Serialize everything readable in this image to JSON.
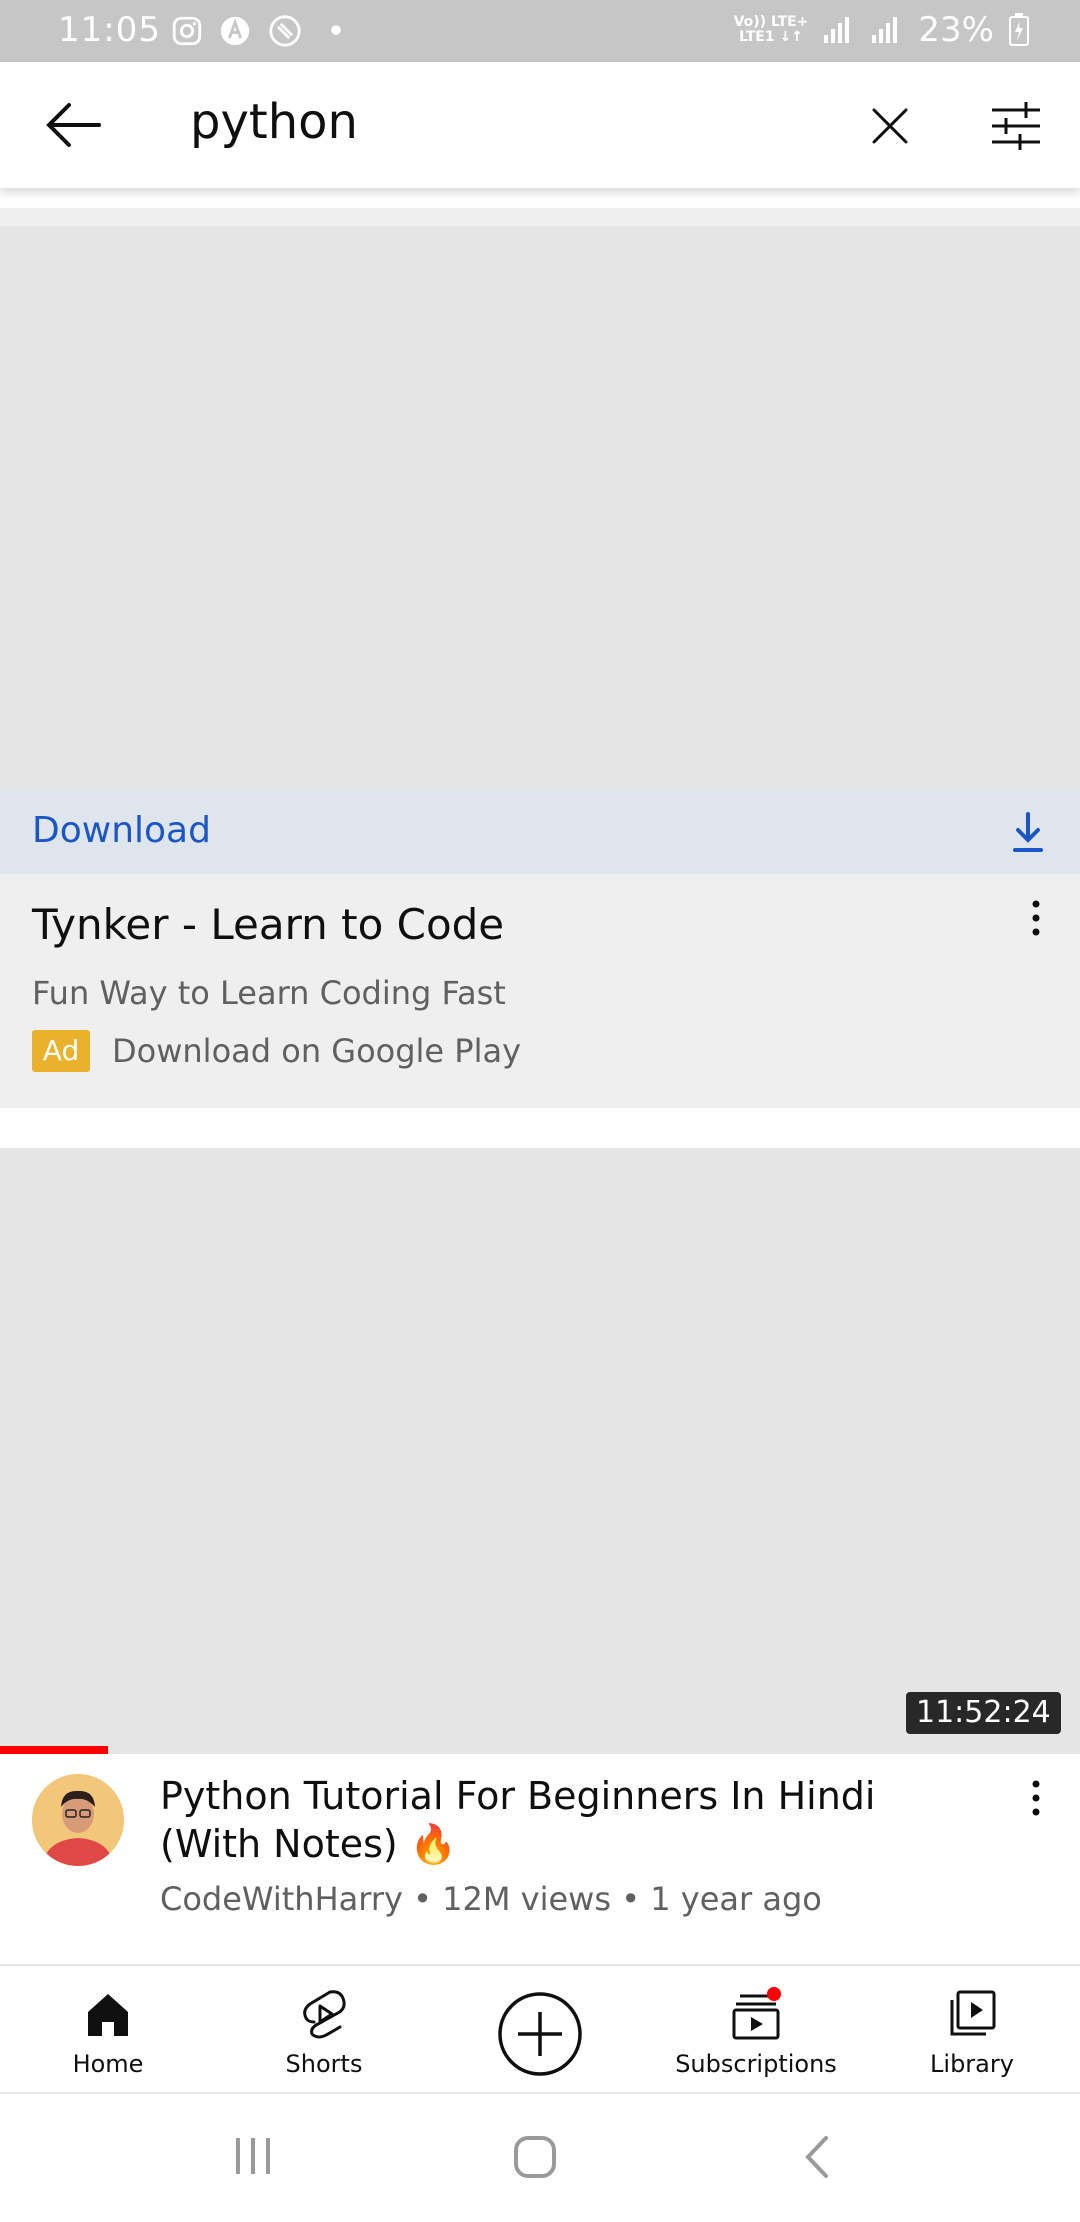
{
  "status_bar": {
    "time": "11:05",
    "network_top": "Vo)) LTE+",
    "network_bottom": "LTE1 ↓↑",
    "battery": "23%"
  },
  "search": {
    "query": "python"
  },
  "ad": {
    "cta_label": "Download",
    "title": "Tynker - Learn to Code",
    "description": "Fun Way to Learn Coding Fast",
    "badge": "Ad",
    "source": "Download on Google Play"
  },
  "video": {
    "duration": "11:52:24",
    "title": "Python Tutorial For Beginners In Hindi (With Notes) 🔥",
    "channel": "CodeWithHarry",
    "views": "12M views",
    "age": "1 year ago",
    "meta": "CodeWithHarry • 12M views • 1 year ago",
    "watch_progress": 0.1
  },
  "bottom_nav": {
    "home": "Home",
    "shorts": "Shorts",
    "subscriptions": "Subscriptions",
    "library": "Library"
  },
  "colors": {
    "link_blue": "#1a56c4",
    "ad_badge": "#e9b22a",
    "progress_red": "#ff0000",
    "notification_dot": "#ff0000"
  }
}
